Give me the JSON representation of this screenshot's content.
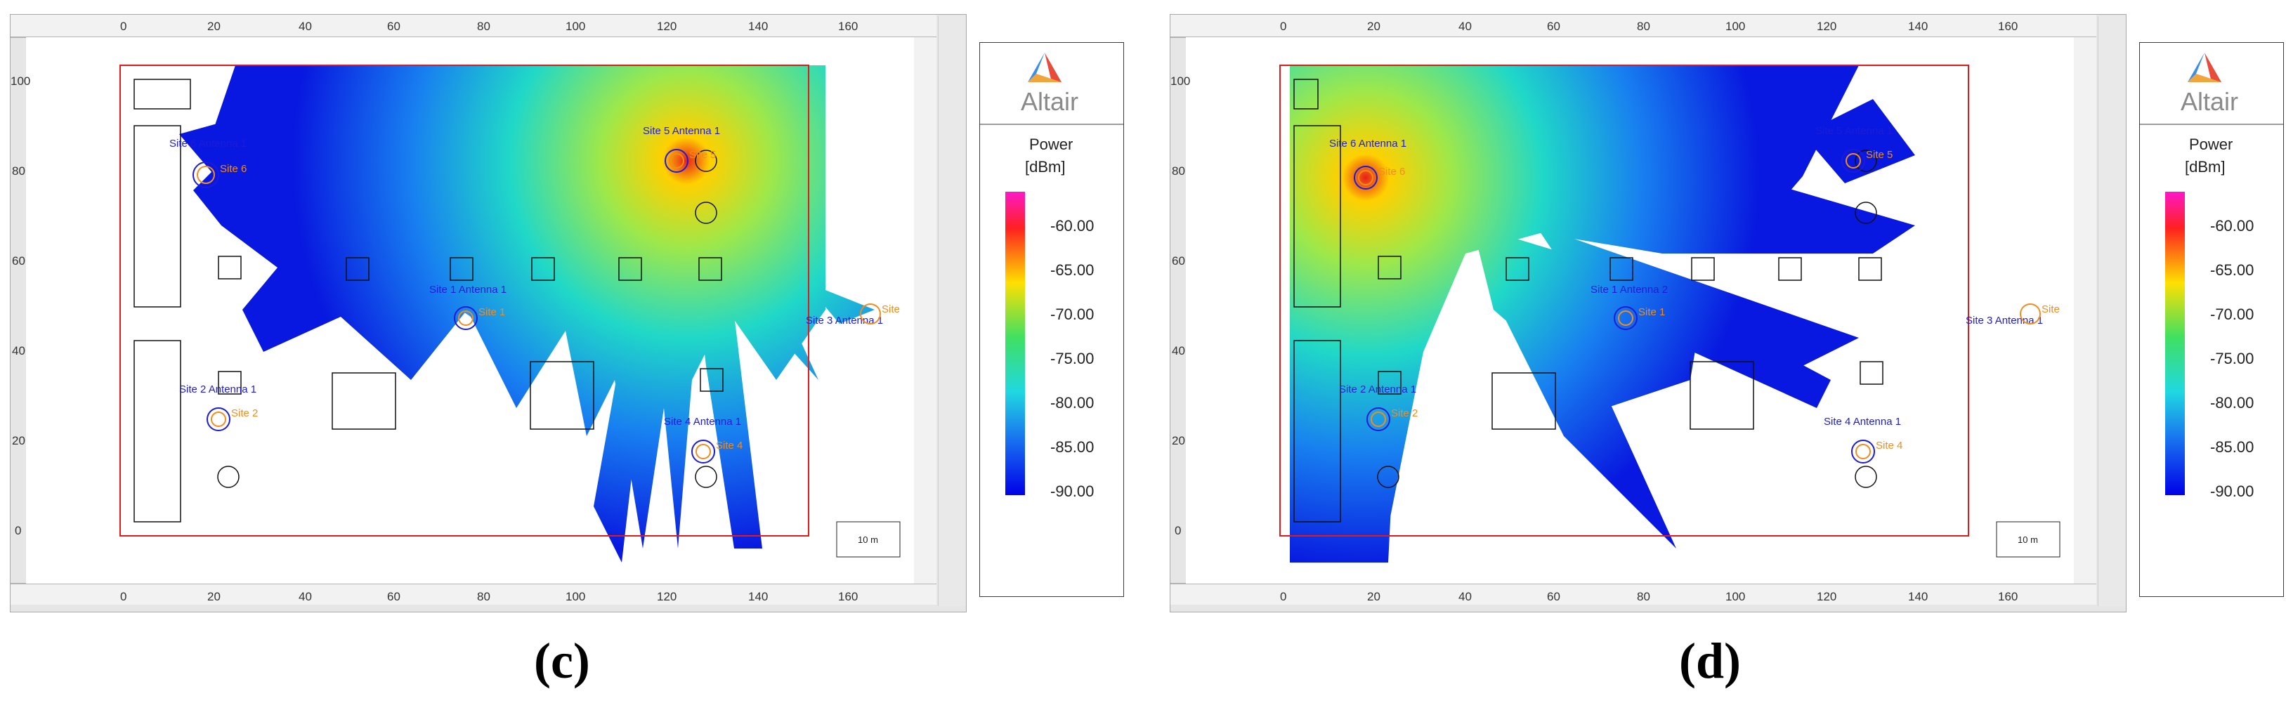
{
  "captions": [
    "(c)",
    "(d)"
  ],
  "ruler": {
    "x_ticks": [
      "0",
      "20",
      "40",
      "60",
      "80",
      "100",
      "120",
      "140",
      "160"
    ],
    "y_ticks": [
      "0",
      "20",
      "40",
      "60",
      "80",
      "100"
    ]
  },
  "legend": {
    "brand": "Altair",
    "title": "Power",
    "unit": "[dBm]",
    "values": [
      "-60.00",
      "-65.00",
      "-70.00",
      "-75.00",
      "-80.00",
      "-85.00",
      "-90.00"
    ]
  },
  "scale_label": "10 m",
  "panels": [
    {
      "id": "c",
      "antennas": [
        {
          "label": "Site  6 Antenna 1",
          "site": "Site  6"
        },
        {
          "label": "Site  5 Antenna 1",
          "site": "Site  5"
        },
        {
          "label": "Site  1 Antenna 1",
          "site": "Site  1"
        },
        {
          "label": "Site  3 Antenna 1",
          "site": "Site"
        },
        {
          "label": "Site  2 Antenna 1",
          "site": "Site  2"
        },
        {
          "label": "Site  4 Antenna 1",
          "site": "Site  4"
        }
      ]
    },
    {
      "id": "d",
      "antennas": [
        {
          "label": "Site  6 Antenna 1",
          "site": "Site  6"
        },
        {
          "label": "Site  5 Antenna 1",
          "site": "Site  5"
        },
        {
          "label": "Site  1 Antenna 2",
          "site": "Site  1"
        },
        {
          "label": "Site  3 Antenna 1",
          "site": "Site"
        },
        {
          "label": "Site  2 Antenna 1",
          "site": "Site  2"
        },
        {
          "label": "Site  4 Antenna 1",
          "site": "Site  4"
        }
      ]
    }
  ],
  "colors": {
    "frame": "#e31a1c",
    "site_label": "#1c1cd8",
    "site_marker": "#f28c1e"
  }
}
